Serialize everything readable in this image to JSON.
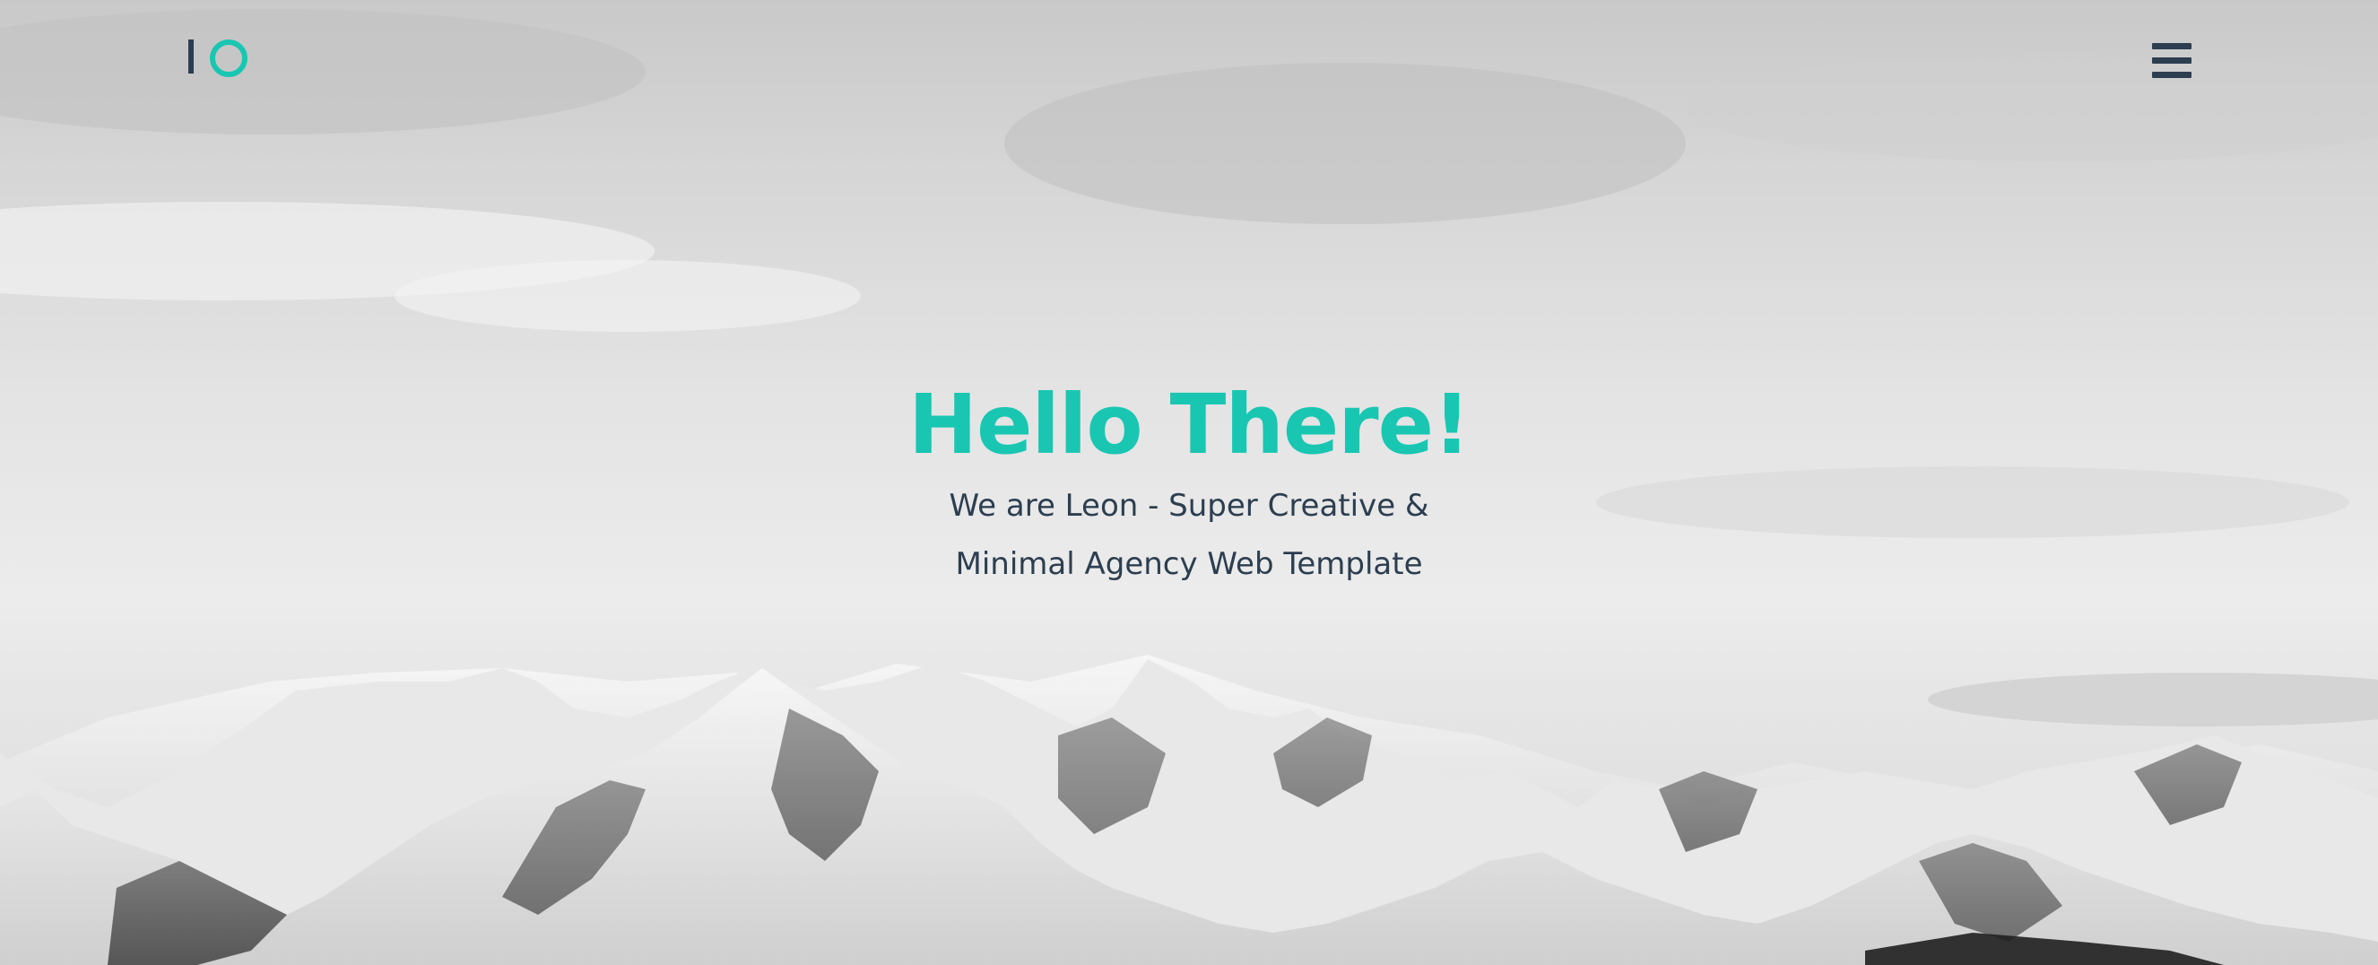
{
  "header": {
    "logo_name": "leon-logo",
    "menu_icon": "hamburger-menu-icon"
  },
  "hero": {
    "title": "Hello There!",
    "subtitle_line1": "We are Leon - Super Creative &",
    "subtitle_line2": "Minimal Agency Web Template",
    "background": "snowy-mountain-range-photo"
  },
  "colors": {
    "accent": "#19c6b2",
    "text_dark": "#2c3e50"
  }
}
